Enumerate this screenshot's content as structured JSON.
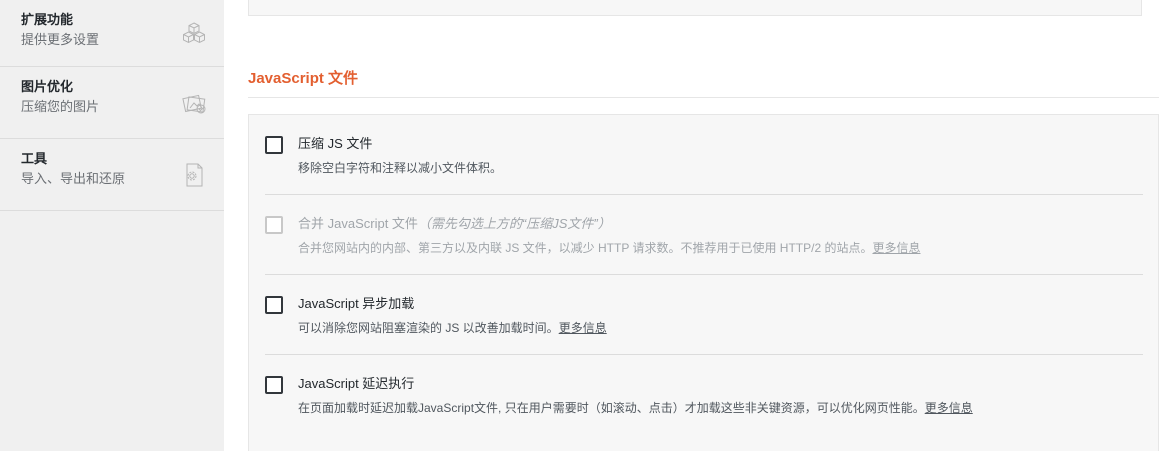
{
  "sidebar": {
    "items": [
      {
        "title": "扩展功能",
        "subtitle": "提供更多设置",
        "icon": "cubes-icon"
      },
      {
        "title": "图片优化",
        "subtitle": "压缩您的图片",
        "icon": "images-icon"
      },
      {
        "title": "工具",
        "subtitle": "导入、导出和还原",
        "icon": "gear-document-icon"
      }
    ]
  },
  "main": {
    "section_title": "JavaScript 文件",
    "options": [
      {
        "label": "压缩 JS 文件",
        "note": "",
        "description": "移除空白字符和注释以减小文件体积。",
        "more": "",
        "disabled": false,
        "checked": false
      },
      {
        "label": "合并 JavaScript 文件",
        "note": "（需先勾选上方的“压缩JS文件”）",
        "description": "合并您网站内的内部、第三方以及内联 JS 文件，以减少 HTTP 请求数。不推荐用于已使用 HTTP/2 的站点。",
        "more": "更多信息",
        "disabled": true,
        "checked": false
      },
      {
        "label": "JavaScript 异步加载",
        "note": "",
        "description": "可以消除您网站阻塞渲染的 JS 以改善加载时间。",
        "more": "更多信息",
        "disabled": false,
        "checked": false
      },
      {
        "label": "JavaScript 延迟执行",
        "note": "",
        "description": "在页面加载时延迟加载JavaScript文件, 只在用户需要时（如滚动、点击）才加载这些非关键资源，可以优化网页性能。",
        "more": "更多信息",
        "disabled": false,
        "checked": false
      }
    ]
  }
}
